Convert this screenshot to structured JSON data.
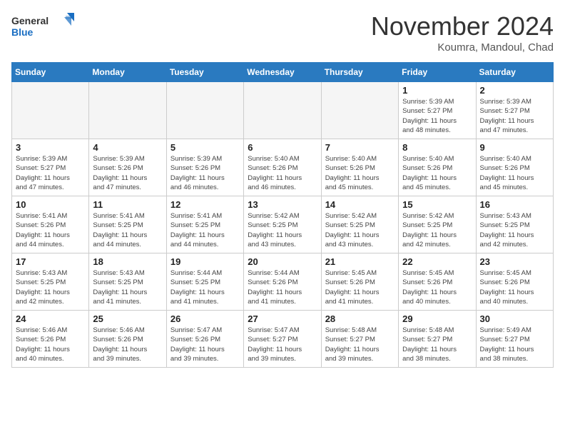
{
  "logo": {
    "line1": "General",
    "line2": "Blue"
  },
  "title": "November 2024",
  "location": "Koumra, Mandoul, Chad",
  "days_of_week": [
    "Sunday",
    "Monday",
    "Tuesday",
    "Wednesday",
    "Thursday",
    "Friday",
    "Saturday"
  ],
  "weeks": [
    [
      {
        "day": "",
        "info": ""
      },
      {
        "day": "",
        "info": ""
      },
      {
        "day": "",
        "info": ""
      },
      {
        "day": "",
        "info": ""
      },
      {
        "day": "",
        "info": ""
      },
      {
        "day": "1",
        "info": "Sunrise: 5:39 AM\nSunset: 5:27 PM\nDaylight: 11 hours\nand 48 minutes."
      },
      {
        "day": "2",
        "info": "Sunrise: 5:39 AM\nSunset: 5:27 PM\nDaylight: 11 hours\nand 47 minutes."
      }
    ],
    [
      {
        "day": "3",
        "info": "Sunrise: 5:39 AM\nSunset: 5:27 PM\nDaylight: 11 hours\nand 47 minutes."
      },
      {
        "day": "4",
        "info": "Sunrise: 5:39 AM\nSunset: 5:26 PM\nDaylight: 11 hours\nand 47 minutes."
      },
      {
        "day": "5",
        "info": "Sunrise: 5:39 AM\nSunset: 5:26 PM\nDaylight: 11 hours\nand 46 minutes."
      },
      {
        "day": "6",
        "info": "Sunrise: 5:40 AM\nSunset: 5:26 PM\nDaylight: 11 hours\nand 46 minutes."
      },
      {
        "day": "7",
        "info": "Sunrise: 5:40 AM\nSunset: 5:26 PM\nDaylight: 11 hours\nand 45 minutes."
      },
      {
        "day": "8",
        "info": "Sunrise: 5:40 AM\nSunset: 5:26 PM\nDaylight: 11 hours\nand 45 minutes."
      },
      {
        "day": "9",
        "info": "Sunrise: 5:40 AM\nSunset: 5:26 PM\nDaylight: 11 hours\nand 45 minutes."
      }
    ],
    [
      {
        "day": "10",
        "info": "Sunrise: 5:41 AM\nSunset: 5:26 PM\nDaylight: 11 hours\nand 44 minutes."
      },
      {
        "day": "11",
        "info": "Sunrise: 5:41 AM\nSunset: 5:25 PM\nDaylight: 11 hours\nand 44 minutes."
      },
      {
        "day": "12",
        "info": "Sunrise: 5:41 AM\nSunset: 5:25 PM\nDaylight: 11 hours\nand 44 minutes."
      },
      {
        "day": "13",
        "info": "Sunrise: 5:42 AM\nSunset: 5:25 PM\nDaylight: 11 hours\nand 43 minutes."
      },
      {
        "day": "14",
        "info": "Sunrise: 5:42 AM\nSunset: 5:25 PM\nDaylight: 11 hours\nand 43 minutes."
      },
      {
        "day": "15",
        "info": "Sunrise: 5:42 AM\nSunset: 5:25 PM\nDaylight: 11 hours\nand 42 minutes."
      },
      {
        "day": "16",
        "info": "Sunrise: 5:43 AM\nSunset: 5:25 PM\nDaylight: 11 hours\nand 42 minutes."
      }
    ],
    [
      {
        "day": "17",
        "info": "Sunrise: 5:43 AM\nSunset: 5:25 PM\nDaylight: 11 hours\nand 42 minutes."
      },
      {
        "day": "18",
        "info": "Sunrise: 5:43 AM\nSunset: 5:25 PM\nDaylight: 11 hours\nand 41 minutes."
      },
      {
        "day": "19",
        "info": "Sunrise: 5:44 AM\nSunset: 5:25 PM\nDaylight: 11 hours\nand 41 minutes."
      },
      {
        "day": "20",
        "info": "Sunrise: 5:44 AM\nSunset: 5:26 PM\nDaylight: 11 hours\nand 41 minutes."
      },
      {
        "day": "21",
        "info": "Sunrise: 5:45 AM\nSunset: 5:26 PM\nDaylight: 11 hours\nand 41 minutes."
      },
      {
        "day": "22",
        "info": "Sunrise: 5:45 AM\nSunset: 5:26 PM\nDaylight: 11 hours\nand 40 minutes."
      },
      {
        "day": "23",
        "info": "Sunrise: 5:45 AM\nSunset: 5:26 PM\nDaylight: 11 hours\nand 40 minutes."
      }
    ],
    [
      {
        "day": "24",
        "info": "Sunrise: 5:46 AM\nSunset: 5:26 PM\nDaylight: 11 hours\nand 40 minutes."
      },
      {
        "day": "25",
        "info": "Sunrise: 5:46 AM\nSunset: 5:26 PM\nDaylight: 11 hours\nand 39 minutes."
      },
      {
        "day": "26",
        "info": "Sunrise: 5:47 AM\nSunset: 5:26 PM\nDaylight: 11 hours\nand 39 minutes."
      },
      {
        "day": "27",
        "info": "Sunrise: 5:47 AM\nSunset: 5:27 PM\nDaylight: 11 hours\nand 39 minutes."
      },
      {
        "day": "28",
        "info": "Sunrise: 5:48 AM\nSunset: 5:27 PM\nDaylight: 11 hours\nand 39 minutes."
      },
      {
        "day": "29",
        "info": "Sunrise: 5:48 AM\nSunset: 5:27 PM\nDaylight: 11 hours\nand 38 minutes."
      },
      {
        "day": "30",
        "info": "Sunrise: 5:49 AM\nSunset: 5:27 PM\nDaylight: 11 hours\nand 38 minutes."
      }
    ]
  ]
}
